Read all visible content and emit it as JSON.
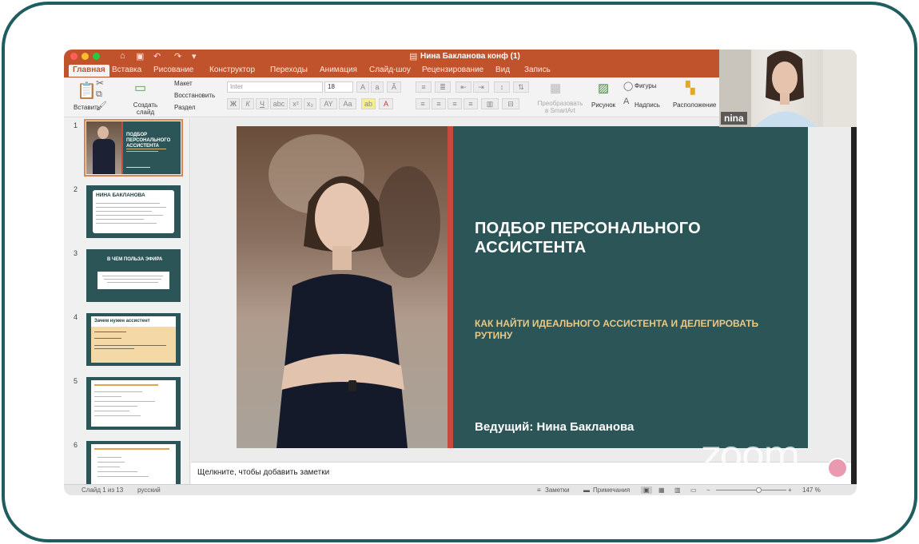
{
  "window": {
    "title": "Нина Бакланова конф (1)"
  },
  "ribbon_tabs": [
    "Главная",
    "Вставка",
    "Рисование",
    "Конструктор",
    "Переходы",
    "Анимация",
    "Слайд-шоу",
    "Рецензирование",
    "Вид",
    "Запись"
  ],
  "ribbon": {
    "paste": "Вставить",
    "new_slide": "Создать слайд",
    "layout": "Макет",
    "reset": "Восстановить",
    "section": "Раздел",
    "font_name": "Inter",
    "font_size": "18",
    "convert_smartart": "Преобразовать в SmartArt",
    "picture": "Рисунок",
    "shapes": "Фигуры",
    "textbox": "Надпись",
    "arrange": "Расположение"
  },
  "thumbnails": [
    {
      "num": "1",
      "title": "ПОДБОР ПЕРСОНАЛЬНОГО АССИСТЕНТА"
    },
    {
      "num": "2",
      "title": "НИНА БАКЛАНОВА"
    },
    {
      "num": "3",
      "title": "В ЧЕМ ПОЛЬЗА ЭФИРА"
    },
    {
      "num": "4",
      "title": "Зачем нужен ассистент"
    },
    {
      "num": "5",
      "title": ""
    },
    {
      "num": "6",
      "title": ""
    }
  ],
  "slide": {
    "title": "ПОДБОР ПЕРСОНАЛЬНОГО АССИСТЕНТА",
    "subtitle": "КАК НАЙТИ ИДЕАЛЬНОГО АССИСТЕНТА И ДЕЛЕГИРОВАТЬ РУТИНУ",
    "host": "Ведущий: Нина Бакланова"
  },
  "notes_placeholder": "Щелкните, чтобы добавить заметки",
  "status": {
    "slide_counter": "Слайд 1 из 13",
    "language": "русский",
    "notes": "Заметки",
    "comments": "Примечания",
    "zoom": "147 %"
  },
  "webcam": {
    "name": "nina"
  },
  "watermark": "zoom",
  "colors": {
    "accent": "#c0522c",
    "slide_bg": "#2c5557",
    "frame": "#1f5d5e",
    "subtitle": "#e7c887"
  }
}
